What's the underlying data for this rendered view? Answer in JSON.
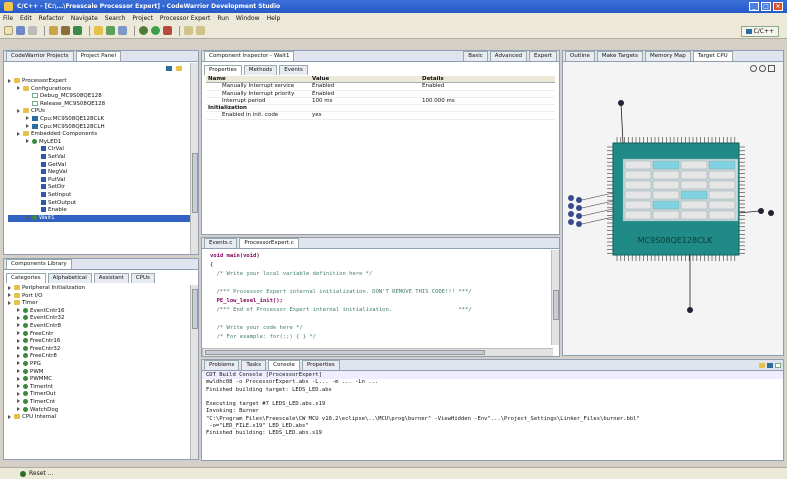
{
  "window": {
    "title": "C/C++ - [C:\\...\\Freescale Processor Expert] - CodeWarrior Development Studio",
    "controls": [
      "_",
      "□",
      "×"
    ]
  },
  "menubar": [
    "File",
    "Edit",
    "Refactor",
    "Navigate",
    "Search",
    "Project",
    "Processor Expert",
    "Run",
    "Window",
    "Help"
  ],
  "toolbar": {
    "perspective_label": "C/C++"
  },
  "project_panel": {
    "tabs": [
      {
        "label": "CodeWarrior Projects",
        "active": false
      },
      {
        "label": "Project Panel",
        "active": true
      }
    ],
    "tree": [
      {
        "label": "ProcessorExpert",
        "depth": 0,
        "icon": "folder-icon"
      },
      {
        "label": "Configurations",
        "depth": 1,
        "icon": "folder-icon"
      },
      {
        "label": "Debug_MC9S08QE128",
        "depth": 2,
        "icon": "file-icon"
      },
      {
        "label": "Release_MC9S08QE128",
        "depth": 2,
        "icon": "file-icon"
      },
      {
        "label": "CPUs",
        "depth": 1,
        "icon": "folder-icon"
      },
      {
        "label": "Cpu:MC9S08QE128CLK",
        "depth": 2,
        "icon": "chip-icon"
      },
      {
        "label": "Cpu:MC9S08QE128CLH",
        "depth": 2,
        "icon": "chip-icon"
      },
      {
        "label": "Embedded Components",
        "depth": 1,
        "icon": "folder-icon"
      },
      {
        "label": "MyLED1",
        "depth": 2,
        "icon": "bean-icon"
      },
      {
        "label": "ClrVal",
        "depth": 3,
        "icon": "method-icon"
      },
      {
        "label": "SetVal",
        "depth": 3,
        "icon": "method-icon"
      },
      {
        "label": "GetVal",
        "depth": 3,
        "icon": "method-icon"
      },
      {
        "label": "NegVal",
        "depth": 3,
        "icon": "method-icon"
      },
      {
        "label": "PutVal",
        "depth": 3,
        "icon": "method-icon"
      },
      {
        "label": "SetDir",
        "depth": 3,
        "icon": "method-icon"
      },
      {
        "label": "SetInput",
        "depth": 3,
        "icon": "method-icon"
      },
      {
        "label": "SetOutput",
        "depth": 3,
        "icon": "method-icon"
      },
      {
        "label": "Enable",
        "depth": 3,
        "icon": "method-icon"
      },
      {
        "label": "Wait1",
        "depth": 2,
        "icon": "bean-icon",
        "selected": true
      }
    ]
  },
  "component_library": {
    "title": "Components Library",
    "tabs": [
      {
        "label": "Categories",
        "active": true
      },
      {
        "label": "Alphabetical",
        "active": false
      },
      {
        "label": "Assistant",
        "active": false
      },
      {
        "label": "CPUs",
        "active": false
      }
    ],
    "tree": [
      {
        "label": "Peripheral Initialization",
        "depth": 0,
        "icon": "folder-icon"
      },
      {
        "label": "Port I/O",
        "depth": 0,
        "icon": "folder-icon"
      },
      {
        "label": "Timer",
        "depth": 0,
        "icon": "folder-icon"
      },
      {
        "label": "EventCntr16",
        "depth": 1,
        "icon": "bean-icon"
      },
      {
        "label": "EventCntr32",
        "depth": 1,
        "icon": "bean-icon"
      },
      {
        "label": "EventCntr8",
        "depth": 1,
        "icon": "bean-icon"
      },
      {
        "label": "FreeCntr",
        "depth": 1,
        "icon": "bean-icon"
      },
      {
        "label": "FreeCntr16",
        "depth": 1,
        "icon": "bean-icon"
      },
      {
        "label": "FreeCntr32",
        "depth": 1,
        "icon": "bean-icon"
      },
      {
        "label": "FreeCntr8",
        "depth": 1,
        "icon": "bean-icon"
      },
      {
        "label": "PPG",
        "depth": 1,
        "icon": "bean-icon"
      },
      {
        "label": "PWM",
        "depth": 1,
        "icon": "bean-icon"
      },
      {
        "label": "PWMMC",
        "depth": 1,
        "icon": "bean-icon"
      },
      {
        "label": "TimerInt",
        "depth": 1,
        "icon": "bean-icon"
      },
      {
        "label": "TimerOut",
        "depth": 1,
        "icon": "bean-icon"
      },
      {
        "label": "TimerCnt",
        "depth": 1,
        "icon": "bean-icon"
      },
      {
        "label": "WatchDog",
        "depth": 1,
        "icon": "bean-icon"
      },
      {
        "label": "CPU Internal",
        "depth": 0,
        "icon": "folder-icon"
      }
    ]
  },
  "inspector": {
    "title": "Component Inspector - Wait1",
    "mode_buttons": [
      "Basic",
      "Advanced",
      "Expert"
    ],
    "tabs": [
      {
        "label": "Properties",
        "active": true
      },
      {
        "label": "Methods",
        "active": false
      },
      {
        "label": "Events",
        "active": false
      }
    ],
    "columns": [
      "Name",
      "Value",
      "Details"
    ],
    "rows": [
      {
        "name": "Manually Interrupt service",
        "value": "Enabled",
        "details": "Enabled",
        "indent": 1
      },
      {
        "name": "Manually Interrupt priority",
        "value": "Enabled",
        "details": "",
        "indent": 1
      },
      {
        "name": "Interrupt period",
        "value": "100 ms",
        "details": "100.000 ms",
        "indent": 1
      },
      {
        "name": "Initialization",
        "value": "",
        "details": "",
        "indent": 0
      },
      {
        "name": "Enabled in init. code",
        "value": "yes",
        "details": "",
        "indent": 1
      }
    ]
  },
  "editor": {
    "tabs": [
      {
        "label": "Events.c",
        "active": false
      },
      {
        "label": "ProcessorExpert.c",
        "active": true
      }
    ],
    "lines": [
      "void main(void)",
      "{",
      "  /* Write your local variable definition here */",
      "",
      "  /*** Processor Expert internal initialization. DON'T REMOVE THIS CODE!!! ***/",
      "  PE_low_level_init();",
      "  /*** End of Processor Expert internal initialization.                    ***/",
      "",
      "  /* Write your code here */",
      "  /* For example: for(;;) { } */"
    ]
  },
  "right_panel": {
    "tabs": [
      {
        "label": "Outline",
        "active": false
      },
      {
        "label": "Make Targets",
        "active": false
      },
      {
        "label": "Memory Map",
        "active": false
      },
      {
        "label": "Target CPU",
        "active": true
      }
    ],
    "chip_label": "MC9S08QE128CLK",
    "chip_color": "#1f8a86"
  },
  "console": {
    "tabs": [
      {
        "label": "Problems",
        "active": false
      },
      {
        "label": "Tasks",
        "active": false
      },
      {
        "label": "Console",
        "active": true
      },
      {
        "label": "Properties",
        "active": false
      }
    ],
    "header": "CDT Build Console [ProcessorExpert]",
    "lines": [
      "mwldhc08 -o ProcessorExpert.abs -L... -m ... -Ln ...",
      "Finished building target: LEDS_LED.abs",
      " ",
      "Executing target #7 LEDS_LED.abs.s19",
      "Invoking: Burner",
      "\"C:\\Program Files\\Freescale\\CW MCU v10.2\\eclipse\\..\\MCU\\prog\\burner\" -ViewHidden -Env\"...\\Project_Settings\\Linker_Files\\burner.bbl\"",
      " -o=\"LED_FILE.s19\" LED_LED.abs\"",
      "Finished building: LEDS_LED.abs.s19",
      " "
    ]
  },
  "status": {
    "text": "Reset ..."
  }
}
